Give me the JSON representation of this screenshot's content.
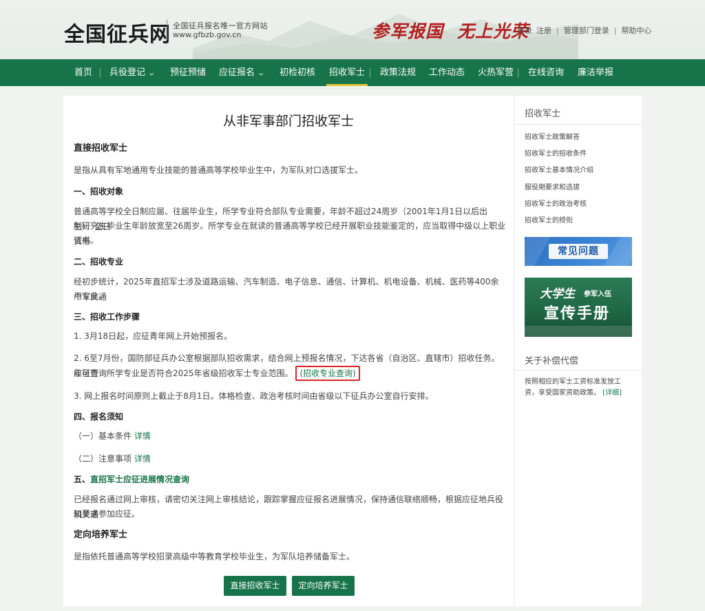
{
  "header": {
    "site_title": "全国征兵网",
    "sub_title": "全国征兵报名唯一官方网站",
    "domain": "www.gfbzb.gov.cn",
    "slogan_left": "参军报国",
    "slogan_right": "无上光荣",
    "links": {
      "login": "登录",
      "register": "注册",
      "admin_login": "管理部门登录",
      "help": "帮助中心"
    }
  },
  "nav": {
    "items": [
      {
        "label": "首页"
      },
      {
        "label": "兵役登记",
        "dropdown": true
      },
      {
        "label": "预征预储"
      },
      {
        "label": "应征报名",
        "dropdown": true
      },
      {
        "label": "初检初核"
      },
      {
        "label": "招收军士",
        "active": true
      },
      {
        "label": "政策法规"
      },
      {
        "label": "工作动态"
      },
      {
        "label": "火热军营"
      },
      {
        "label": "在线咨询"
      },
      {
        "label": "廉洁举报"
      }
    ]
  },
  "article": {
    "title": "从非军事部门招收军士",
    "s1_heading": "直接招收军士",
    "s1_intro": "是指从具有军地通用专业技能的普通高等学校毕业生中，为军队对口选拔军士。",
    "p1_heading": "一、招收对象",
    "p1_line1": "普通高等学校全日制应届、往届毕业生，所学专业符合部队专业需要，年龄不超过24周岁（2001年1月1日以后出生），全日",
    "p1_line2": "制研究生毕业生年龄放宽至26周岁。所学专业在就读的普通高等学校已经开展职业技能鉴定的，应当取得中级以上职业资格",
    "p1_line3": "证书。",
    "p2_heading": "二、招收专业",
    "p2_line1": "经初步统计，2025年直招军士涉及道路运输、汽车制造、电子信息、通信、计算机、机电设备、机械、医药等400余个军民通",
    "p2_line2": "用专业。",
    "p3_heading": "三、招收工作步骤",
    "p3_step1": "1. 3月18日起，应征青年网上开始预报名。",
    "p3_step2_line1": "2. 6至7月份，国防部征兵办公室根据部队招收需求，结合网上预报名情况，下达各省（自治区、直辖市）招收任务。应征青",
    "p3_step2_line2": "年可查询所学专业是否符合2025年省级招收军士专业范围。",
    "p3_step2_link": "(招收专业查询)",
    "p3_step3": "3. 网上报名时间原则上截止于8月1日。体格检查、政治考核时间由省级以下征兵办公室自行安排。",
    "p4_heading": "四、报名须知",
    "p4_item1": "（一）基本条件",
    "p4_item2": "（二）注意事项",
    "detail_link": "详情",
    "p5_prefix": "五、",
    "p5_heading_link": "直招军士应征进展情况查询",
    "p5_line1": "已经报名通过网上审核，请密切关注网上审核结论，跟踪掌握应征报名进展情况，保持通信联络顺畅，根据应征地兵役机关通",
    "p5_line2": "知要求参加应征。",
    "s2_heading": "定向培养军士",
    "s2_intro": "是指依托普通高等学校招录高级中等教育学校毕业生，为军队培养储备军士。",
    "btn_direct": "直接招收军士",
    "btn_oriented": "定向培养军士"
  },
  "sidebar": {
    "heading1": "招收军士",
    "links": [
      "招收军士政策解答",
      "招收军士的招收条件",
      "招收军士基本情况介绍",
      "服役期要求和选拔",
      "招收军士的政治考核",
      "招收军士的授衔"
    ],
    "banner_faq": "常见问题",
    "banner_handbook_t1": "大学生",
    "banner_handbook_t1s": "参军入伍",
    "banner_handbook_t2": "宣传手册",
    "heading2": "关于补偿代偿",
    "comp_line1": "按照相应的军士工资标准发放工",
    "comp_line2": "资，享受国家资助政策。",
    "comp_link": "[详细]"
  }
}
